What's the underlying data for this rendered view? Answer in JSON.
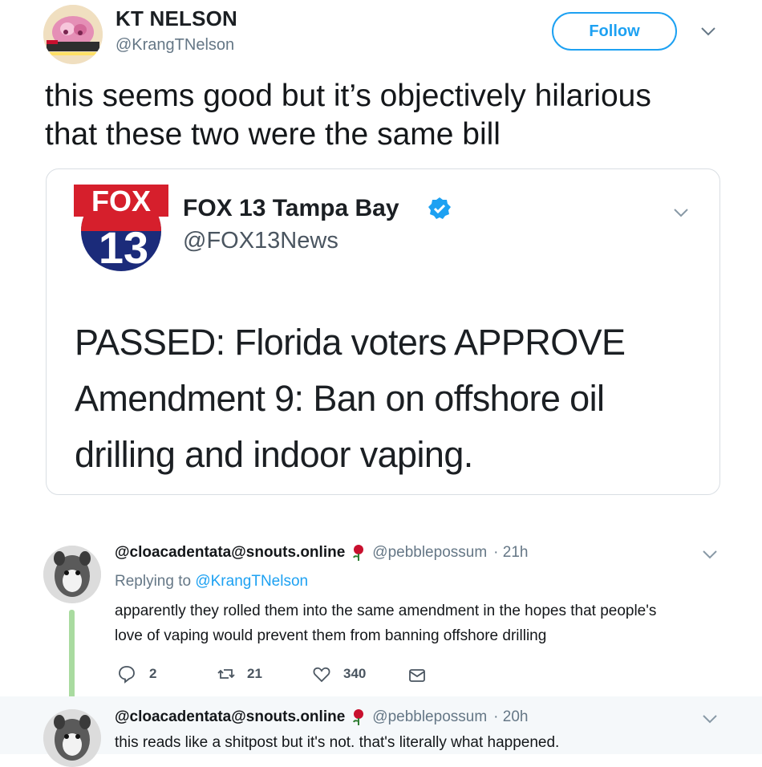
{
  "tweet": {
    "author_name": "KT NELSON",
    "author_handle": "@KrangTNelson",
    "follow_label": "Follow",
    "text_line1": "this seems good but it’s objectively hilarious",
    "text_line2": "that these two were the same bill"
  },
  "quote": {
    "logo_text_top": "FOX",
    "logo_text_num": "13",
    "name": "FOX 13 Tampa Bay",
    "handle": "@FOX13News",
    "text_line1": "PASSED: Florida voters APPROVE",
    "text_line2": "Amendment 9: Ban on offshore oil",
    "text_line3": "drilling and indoor vaping."
  },
  "replies": [
    {
      "name": "@cloacadentata@snouts.online",
      "handle": "@pebblepossum",
      "time": "· 21h",
      "replying_prefix": "Replying to ",
      "replying_to": "@KrangTNelson",
      "text_line1": "apparently they rolled them into the same amendment in the hopes that people's",
      "text_line2": "love of vaping would prevent them from banning offshore drilling",
      "reply_count": "2",
      "retweet_count": "21",
      "like_count": "340"
    },
    {
      "name": "@cloacadentata@snouts.online",
      "handle": "@pebblepossum",
      "time": "· 20h",
      "text_line1": "this reads like a shitpost but it's not. that's literally what happened."
    }
  ],
  "colors": {
    "accent": "#1da1f2",
    "verified": "#1da1f2",
    "thread_line": "#a9dba0",
    "rose": "#c8102e"
  }
}
